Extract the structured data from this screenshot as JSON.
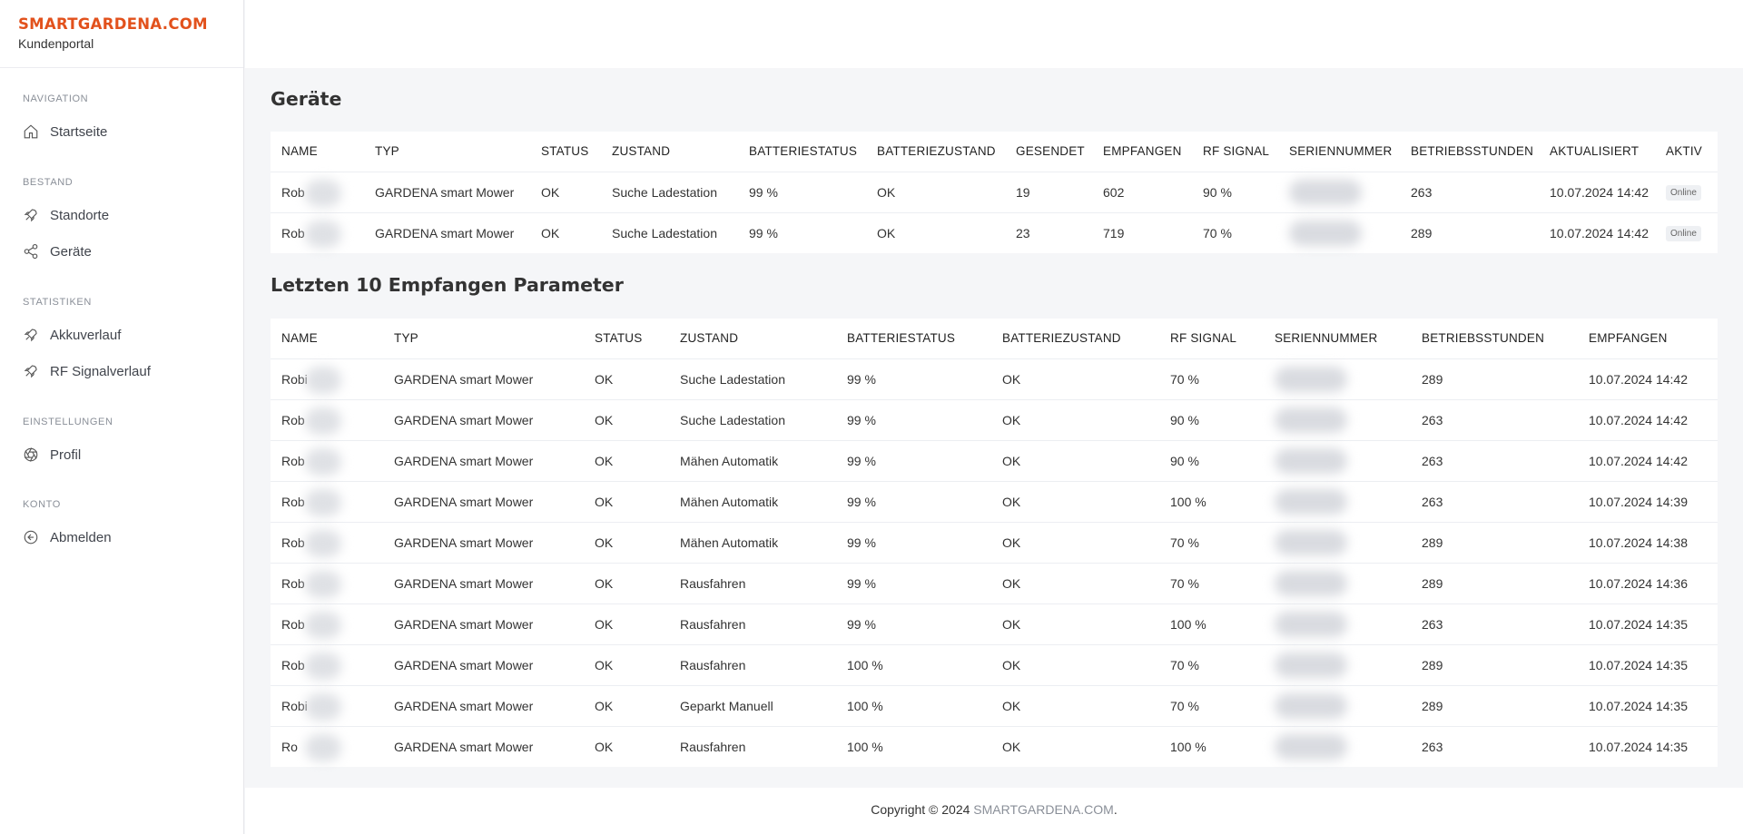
{
  "brand": {
    "name": "SMARTGARDENA.COM",
    "subtitle": "Kundenportal"
  },
  "sidebar": {
    "sections": [
      {
        "label": "NAVIGATION",
        "items": [
          {
            "label": "Startseite",
            "icon": "home-icon"
          }
        ]
      },
      {
        "label": "BESTAND",
        "items": [
          {
            "label": "Standorte",
            "icon": "rocket-icon"
          },
          {
            "label": "Geräte",
            "icon": "share-icon"
          }
        ]
      },
      {
        "label": "STATISTIKEN",
        "items": [
          {
            "label": "Akkuverlauf",
            "icon": "rocket-icon"
          },
          {
            "label": "RF Signalverlauf",
            "icon": "rocket-icon"
          }
        ]
      },
      {
        "label": "EINSTELLUNGEN",
        "items": [
          {
            "label": "Profil",
            "icon": "aperture-icon"
          }
        ]
      },
      {
        "label": "KONTO",
        "items": [
          {
            "label": "Abmelden",
            "icon": "logout-icon"
          }
        ]
      }
    ]
  },
  "devices": {
    "title": "Geräte",
    "columns": [
      "NAME",
      "TYP",
      "STATUS",
      "ZUSTAND",
      "BATTERIESTATUS",
      "BATTERIEZUSTAND",
      "GESENDET",
      "EMPFANGEN",
      "RF SIGNAL",
      "SERIENNUMMER",
      "BETRIEBSSTUNDEN",
      "AKTUALISIERT",
      "AKTIV"
    ],
    "rows": [
      [
        "Rob",
        "GARDENA smart Mower",
        "OK",
        "Suche Ladestation",
        "99 %",
        "OK",
        "19",
        "602",
        "90 %",
        "",
        "263",
        "10.07.2024 14:42",
        "Online"
      ],
      [
        "Rob",
        "GARDENA smart Mower",
        "OK",
        "Suche Ladestation",
        "99 %",
        "OK",
        "23",
        "719",
        "70 %",
        "",
        "289",
        "10.07.2024 14:42",
        "Online"
      ]
    ]
  },
  "params": {
    "title": "Letzten 10 Empfangen Parameter",
    "columns": [
      "NAME",
      "TYP",
      "STATUS",
      "ZUSTAND",
      "BATTERIESTATUS",
      "BATTERIEZUSTAND",
      "RF SIGNAL",
      "SERIENNUMMER",
      "BETRIEBSSTUNDEN",
      "EMPFANGEN"
    ],
    "rows": [
      [
        "Robi",
        "GARDENA smart Mower",
        "OK",
        "Suche Ladestation",
        "99 %",
        "OK",
        "70 %",
        "",
        "289",
        "10.07.2024 14:42"
      ],
      [
        "Rob",
        "GARDENA smart Mower",
        "OK",
        "Suche Ladestation",
        "99 %",
        "OK",
        "90 %",
        "",
        "263",
        "10.07.2024 14:42"
      ],
      [
        "Rob",
        "GARDENA smart Mower",
        "OK",
        "Mähen Automatik",
        "99 %",
        "OK",
        "90 %",
        "",
        "263",
        "10.07.2024 14:42"
      ],
      [
        "Rob",
        "GARDENA smart Mower",
        "OK",
        "Mähen Automatik",
        "99 %",
        "OK",
        "100 %",
        "",
        "263",
        "10.07.2024 14:39"
      ],
      [
        "Rob",
        "GARDENA smart Mower",
        "OK",
        "Mähen Automatik",
        "99 %",
        "OK",
        "70 %",
        "",
        "289",
        "10.07.2024 14:38"
      ],
      [
        "Rob",
        "GARDENA smart Mower",
        "OK",
        "Rausfahren",
        "99 %",
        "OK",
        "70 %",
        "",
        "289",
        "10.07.2024 14:36"
      ],
      [
        "Rob",
        "GARDENA smart Mower",
        "OK",
        "Rausfahren",
        "99 %",
        "OK",
        "100 %",
        "",
        "263",
        "10.07.2024 14:35"
      ],
      [
        "Rob",
        "GARDENA smart Mower",
        "OK",
        "Rausfahren",
        "100 %",
        "OK",
        "70 %",
        "",
        "289",
        "10.07.2024 14:35"
      ],
      [
        "Robi",
        "GARDENA smart Mower",
        "OK",
        "Geparkt Manuell",
        "100 %",
        "OK",
        "70 %",
        "",
        "289",
        "10.07.2024 14:35"
      ],
      [
        "Ro",
        "GARDENA smart Mower",
        "OK",
        "Rausfahren",
        "100 %",
        "OK",
        "100 %",
        "",
        "263",
        "10.07.2024 14:35"
      ]
    ]
  },
  "footer": {
    "prefix": "Copyright © 2024 ",
    "link": "SMARTGARDENA.COM",
    "suffix": "."
  }
}
